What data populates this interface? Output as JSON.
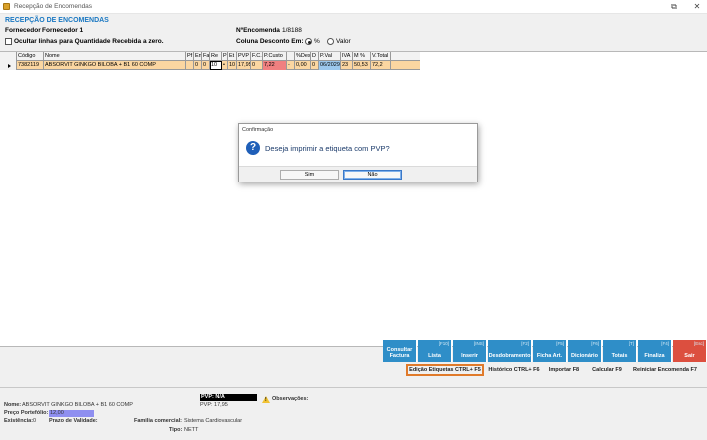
{
  "window": {
    "title": "Recepção de Encomendas",
    "btn_restore": "⧉",
    "btn_close": "✕"
  },
  "header": {
    "heading": "RECEPÇÃO DE ENCOMENDAS",
    "supplier_label": "Fornecedor",
    "supplier_value": "Fornecedor 1",
    "order_label": "NºEncomenda",
    "order_value": "1/8188",
    "hide_lines_label": "Ocultar linhas para Quantidade Recebida a zero.",
    "discount_col_label": "Coluna Desconto Em:",
    "discount_opt_pct": "%",
    "discount_opt_val": "Valor",
    "discount_selected": "%"
  },
  "grid": {
    "columns": [
      "Código",
      "Nome",
      "Pf",
      "En",
      "Fa",
      "Re",
      "P",
      "Et",
      "PVP",
      "F.C.",
      "P.Custo",
      "",
      "%Desc",
      "D",
      "P.Val",
      "IVA",
      "M %",
      "V.Total"
    ],
    "rows": [
      [
        "7382119",
        "ABSORVIT GINKGO BILOBA + B1 60 COMP",
        "",
        "0",
        "0",
        "10",
        "•",
        "10",
        "17,95",
        "0",
        "7,22",
        "-",
        "0,00",
        "0",
        "06/2029",
        "23",
        "50,53",
        "72,2"
      ]
    ]
  },
  "buttons": [
    {
      "key": "",
      "label": "Consultar Factura"
    },
    {
      "key": "[F10]",
      "label": "Lista"
    },
    {
      "key": "[INS]",
      "label": "Inserir"
    },
    {
      "key": "[F2]",
      "label": "Desdobramento"
    },
    {
      "key": "[F5]",
      "label": "Ficha Art."
    },
    {
      "key": "[F6]",
      "label": "Dicionário"
    },
    {
      "key": "[T]",
      "label": "Totais"
    },
    {
      "key": "[F4]",
      "label": "Finaliza"
    },
    {
      "key": "[Esc]",
      "label": "Sair"
    }
  ],
  "sub_buttons": [
    "Edição Etiquetas CTRL+ F5",
    "Histórico CTRL+ F6",
    "Importar F8",
    "Calcular F9",
    "Reiniciar Encomenda F7"
  ],
  "footer": {
    "name_label": "Nome:",
    "name_value": "ABSORVIT GINKGO BILOBA + B1 60 COMP",
    "price_label": "Preço Portefólio:",
    "price_value": "12,00",
    "stock_label": "Existência:",
    "stock_value": "0",
    "expiry_label": "Prazo de Validade:",
    "family_label": "Familia comercial:",
    "family_value": "Sistema Cardiovascular",
    "type_label": "Tipo:",
    "type_value": "NETT",
    "pvp_na": "PVP: N/A",
    "pvp_value": "PVP: 17,95",
    "obs_label": "Observações:"
  },
  "dialog": {
    "title": "Confirmação",
    "message": "Deseja imprimir a etiqueta com PVP?",
    "yes": "Sim",
    "no": "Não"
  },
  "colors": {
    "accent_blue": "#2f8ec8",
    "exit_red": "#dc4f3f",
    "row_orange": "#fbd6a1",
    "cost_red": "#f08080",
    "date_blue": "#9cc8ee",
    "highlight_orange": "#e07a2a"
  }
}
